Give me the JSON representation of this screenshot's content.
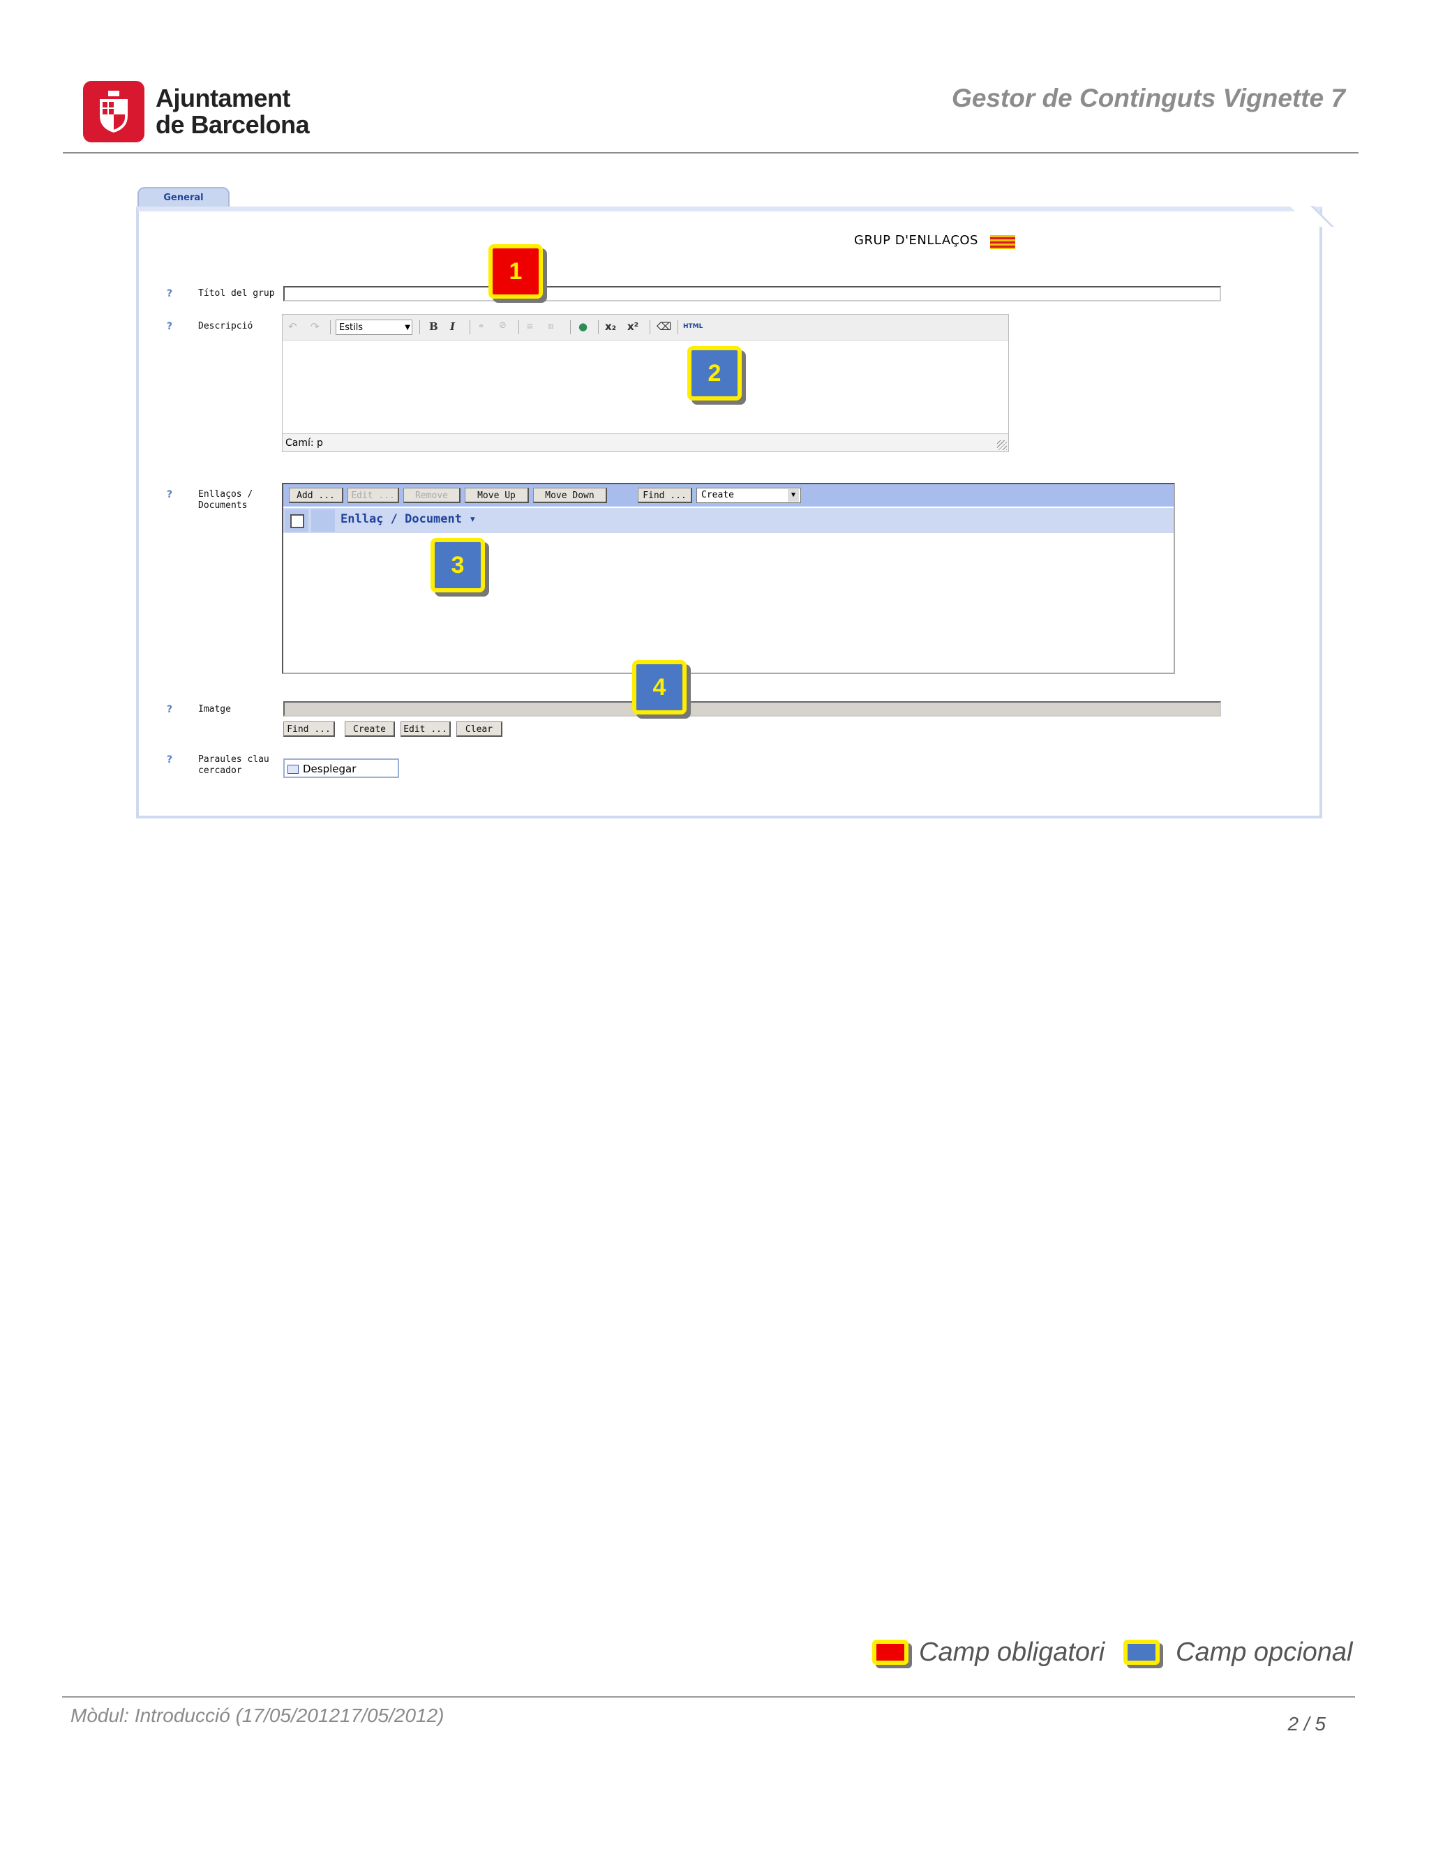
{
  "header": {
    "org_line1": "Ajuntament",
    "org_line2": "de Barcelona",
    "doc_title": "Gestor de Continguts Vignette 7"
  },
  "form": {
    "tab_label": "General",
    "title": "GRUP D'ENLLAÇOS",
    "help_glyph": "?",
    "fields": {
      "titol_label": "Títol del grup",
      "descripcio_label": "Descripció",
      "enllacos_label_1": "Enllaços /",
      "enllacos_label_2": "Documents",
      "imatge_label": "Imatge",
      "paraules_label_1": "Paraules clau",
      "paraules_label_2": "cercador"
    },
    "editor": {
      "styles_value": "Estils",
      "path_text": "Camí: p",
      "html_label": "HTML"
    },
    "links": {
      "buttons": [
        "Add ...",
        "Edit ...",
        "Remove",
        "Move Up",
        "Move Down",
        "Find ..."
      ],
      "create_select": "Create",
      "column_header": "Enllaç / Document"
    },
    "image_buttons": [
      "Find ...",
      "Create",
      "Edit ...",
      "Clear"
    ],
    "desplegar_label": "Desplegar"
  },
  "markers": [
    "1",
    "2",
    "3",
    "4"
  ],
  "legend": {
    "required_label": "Camp obligatori",
    "optional_label": "Camp opcional",
    "required_color": "#ee0000",
    "optional_color": "#4a78c4",
    "border_color": "#ffee00"
  },
  "footer": {
    "module": "Mòdul: Introducció (17/05/201217/05/2012)",
    "page": "2 / 5"
  }
}
